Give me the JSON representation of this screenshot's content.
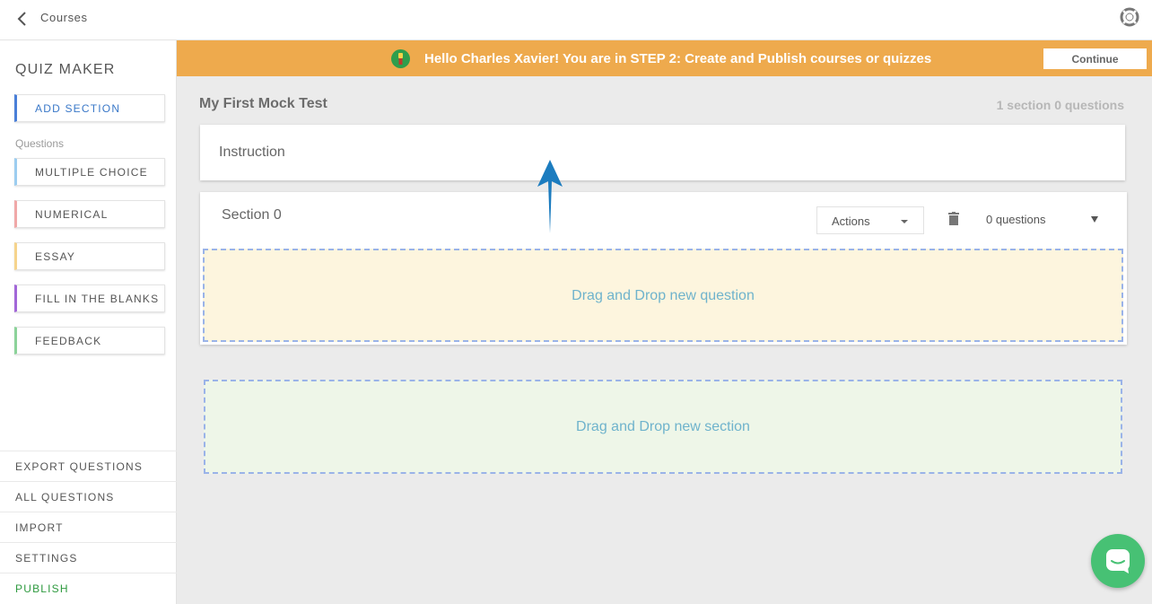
{
  "topbar": {
    "breadcrumb": "Courses",
    "back_icon": "chevron-left-icon",
    "help_icon": "lifebuoy-icon"
  },
  "sidebar": {
    "title": "QUIZ MAKER",
    "add_section": "ADD SECTION",
    "questions_label": "Questions",
    "question_types": [
      {
        "label": "MULTIPLE CHOICE",
        "color": "#9ccdf0"
      },
      {
        "label": "NUMERICAL",
        "color": "#f0a8a8"
      },
      {
        "label": "ESSAY",
        "color": "#f6d48c"
      },
      {
        "label": "FILL IN THE BLANKS",
        "color": "#a267d8"
      },
      {
        "label": "FEEDBACK",
        "color": "#8cd39a"
      }
    ],
    "bottom_links": [
      "EXPORT QUESTIONS",
      "ALL QUESTIONS",
      "IMPORT",
      "SETTINGS",
      "PUBLISH"
    ]
  },
  "banner": {
    "message": "Hello Charles Xavier! You are in STEP 2: Create and Publish courses or quizzes",
    "continue_label": "Continue",
    "color": "#eeaa4d"
  },
  "test": {
    "title": "My First Mock Test",
    "meta": "1 section 0 questions",
    "instruction_label": "Instruction"
  },
  "section": {
    "title": "Section 0",
    "actions_label": "Actions",
    "question_count": "0 questions",
    "drop_question": "Drag and Drop new question"
  },
  "drop_section": "Drag and Drop new section"
}
